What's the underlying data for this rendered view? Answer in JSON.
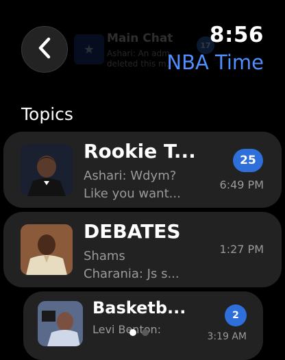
{
  "header": {
    "time": "8:56",
    "app_title": "NBA Time",
    "back_icon": "chevron-left-icon"
  },
  "ghost_item": {
    "title": "Main Chat",
    "message_line1": "Ashari: An adm...",
    "message_line2": "deleted this m...",
    "badge": "17"
  },
  "section_title": "Topics",
  "chats": [
    {
      "title": "Rookie T...",
      "line1": "Ashari: Wdym?",
      "line2": "Like you want...",
      "time": "6:49 PM",
      "badge": "25"
    },
    {
      "title": "DEBATES",
      "line1": "Shams",
      "line2": "Charania: Js s...",
      "time": "1:27 PM",
      "badge": null
    },
    {
      "title": "Basketb...",
      "line1": "Levi Benton:",
      "line2": "",
      "time": "3:19 AM",
      "badge": "2"
    }
  ],
  "page_indicator": {
    "pages": 2,
    "current": 1
  },
  "colors": {
    "accent": "#4f8fff",
    "badge": "#2f6fd9",
    "card": "#222222"
  }
}
